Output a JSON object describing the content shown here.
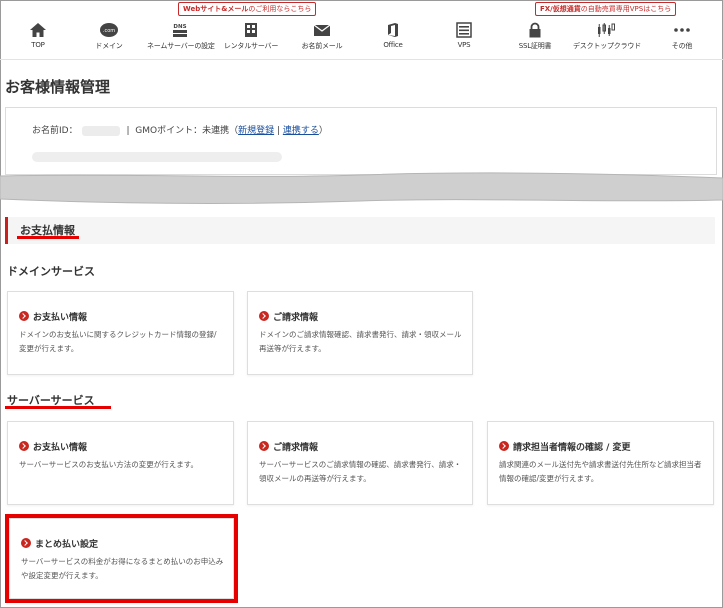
{
  "nav": {
    "promos": [
      {
        "bold": "Webサイト&メール",
        "rest": "のご利用ならこちら"
      },
      {
        "bold": "FX/仮想通貨",
        "rest": "の自動売買専用VPSはこちら"
      }
    ],
    "items": [
      {
        "label": "TOP",
        "icon": "home-icon"
      },
      {
        "label": "ドメイン",
        "icon": "com-icon",
        "icon_text": ".com"
      },
      {
        "label": "ネームサーバーの設定",
        "icon": "dns-icon",
        "icon_text": "DNS"
      },
      {
        "label": "レンタルサーバー",
        "icon": "server-icon"
      },
      {
        "label": "お名前メール",
        "icon": "mail-icon"
      },
      {
        "label": "Office",
        "icon": "office-icon"
      },
      {
        "label": "VPS",
        "icon": "vps-icon"
      },
      {
        "label": "SSL証明書",
        "icon": "lock-icon"
      },
      {
        "label": "デスクトップクラウド",
        "icon": "chart-icon"
      },
      {
        "label": "その他",
        "icon": "more-icon",
        "icon_text": "•••"
      }
    ]
  },
  "page": {
    "title": "お客様情報管理"
  },
  "account": {
    "id_label": "お名前ID：",
    "separator": "|",
    "gmo_text": "GMOポイント：未連携（",
    "register_link": "新規登録",
    "mid_separator": " | ",
    "link_link": "連携する",
    "close_paren": "）"
  },
  "payment": {
    "section_title": "お支払情報",
    "domain_heading": "ドメインサービス",
    "server_heading": "サーバーサービス",
    "domain_cards": [
      {
        "title": "お支払い情報",
        "desc": "ドメインのお支払いに関するクレジットカード情報の登録/変更が行えます。"
      },
      {
        "title": "ご請求情報",
        "desc": "ドメインのご請求情報確認、請求書発行、請求・領収メール再送等が行えます。"
      }
    ],
    "server_cards": [
      {
        "title": "お支払い情報",
        "desc": "サーバーサービスのお支払い方法の変更が行えます。"
      },
      {
        "title": "ご請求情報",
        "desc": "サーバーサービスのご請求情報の確認、請求書発行、請求・領収メールの再送等が行えます。"
      },
      {
        "title": "請求担当者情報の確認 / 変更",
        "desc": "請求関連のメール送付先や請求書送付先住所など請求担当者情報の確認/変更が行えます。"
      },
      {
        "title": "まとめ払い設定",
        "desc": "サーバーサービスの料金がお得になるまとめ払いのお申込みや設定変更が行えます。"
      }
    ]
  },
  "colors": {
    "accent": "#c8261f",
    "highlight": "#e60000",
    "link": "#1a4fa0"
  }
}
